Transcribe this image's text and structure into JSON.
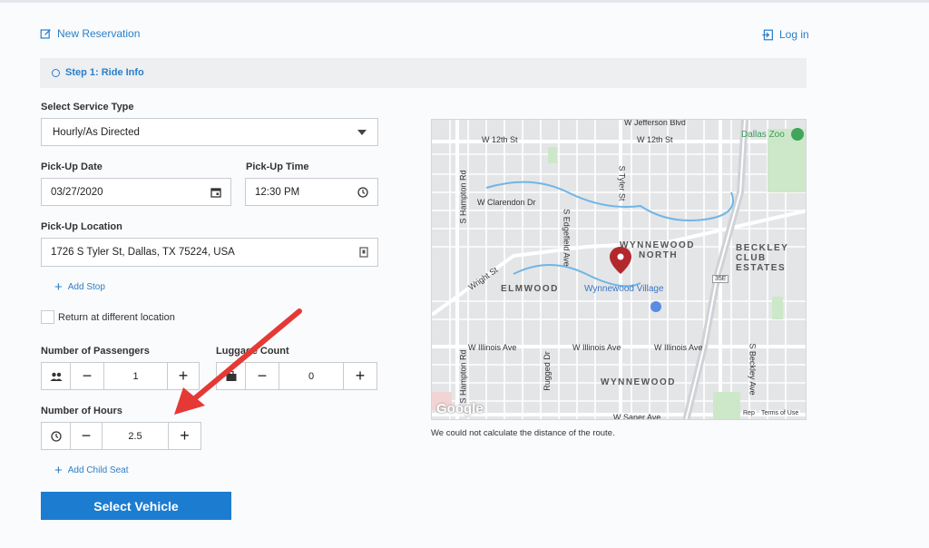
{
  "header": {
    "new_reservation": "New Reservation",
    "login": "Log in"
  },
  "step": {
    "label": "Step 1: Ride Info"
  },
  "service": {
    "label": "Select Service Type",
    "value": "Hourly/As Directed"
  },
  "pickup_date": {
    "label": "Pick-Up Date",
    "value": "03/27/2020"
  },
  "pickup_time": {
    "label": "Pick-Up Time",
    "value": "12:30 PM"
  },
  "pickup_location": {
    "label": "Pick-Up Location",
    "value": "1726 S Tyler St, Dallas, TX 75224, USA"
  },
  "add_stop": "Add Stop",
  "return_diff": "Return at different location",
  "passengers": {
    "label": "Number of Passengers",
    "value": "1"
  },
  "luggage": {
    "label": "Luggage Count",
    "value": "0"
  },
  "hours": {
    "label": "Number of Hours",
    "value": "2.5"
  },
  "add_child_seat": "Add Child Seat",
  "select_vehicle": "Select Vehicle",
  "route_note": "We could not calculate the distance of the route.",
  "map": {
    "areas": [
      "WYNNEWOOD",
      "NORTH",
      "BECKLEY",
      "CLUB ESTATES",
      "ELMWOOD",
      "Wynnewood Village",
      "WYNNEWOOD",
      "Dallas Zoo"
    ],
    "streets": [
      "W 12th St",
      "W 12th St",
      "W Jefferson Blvd",
      "W Clarendon Dr",
      "Wright St",
      "W Illinois Ave",
      "W Illinois Ave",
      "W Illinois Ave",
      "W Saner Ave",
      "S Hampton Rd",
      "S Hampton Rd",
      "S Edgefield Ave",
      "S Tyler St",
      "S Beckley Ave",
      "Rugged Dr",
      "35E"
    ],
    "brand": "Google",
    "footer": "Terms of Use",
    "footer2": "Rep"
  },
  "colors": {
    "accent": "#2a7fc9",
    "button": "#1c7cd0",
    "marker": "#b3282d",
    "arrow": "#e53935"
  }
}
